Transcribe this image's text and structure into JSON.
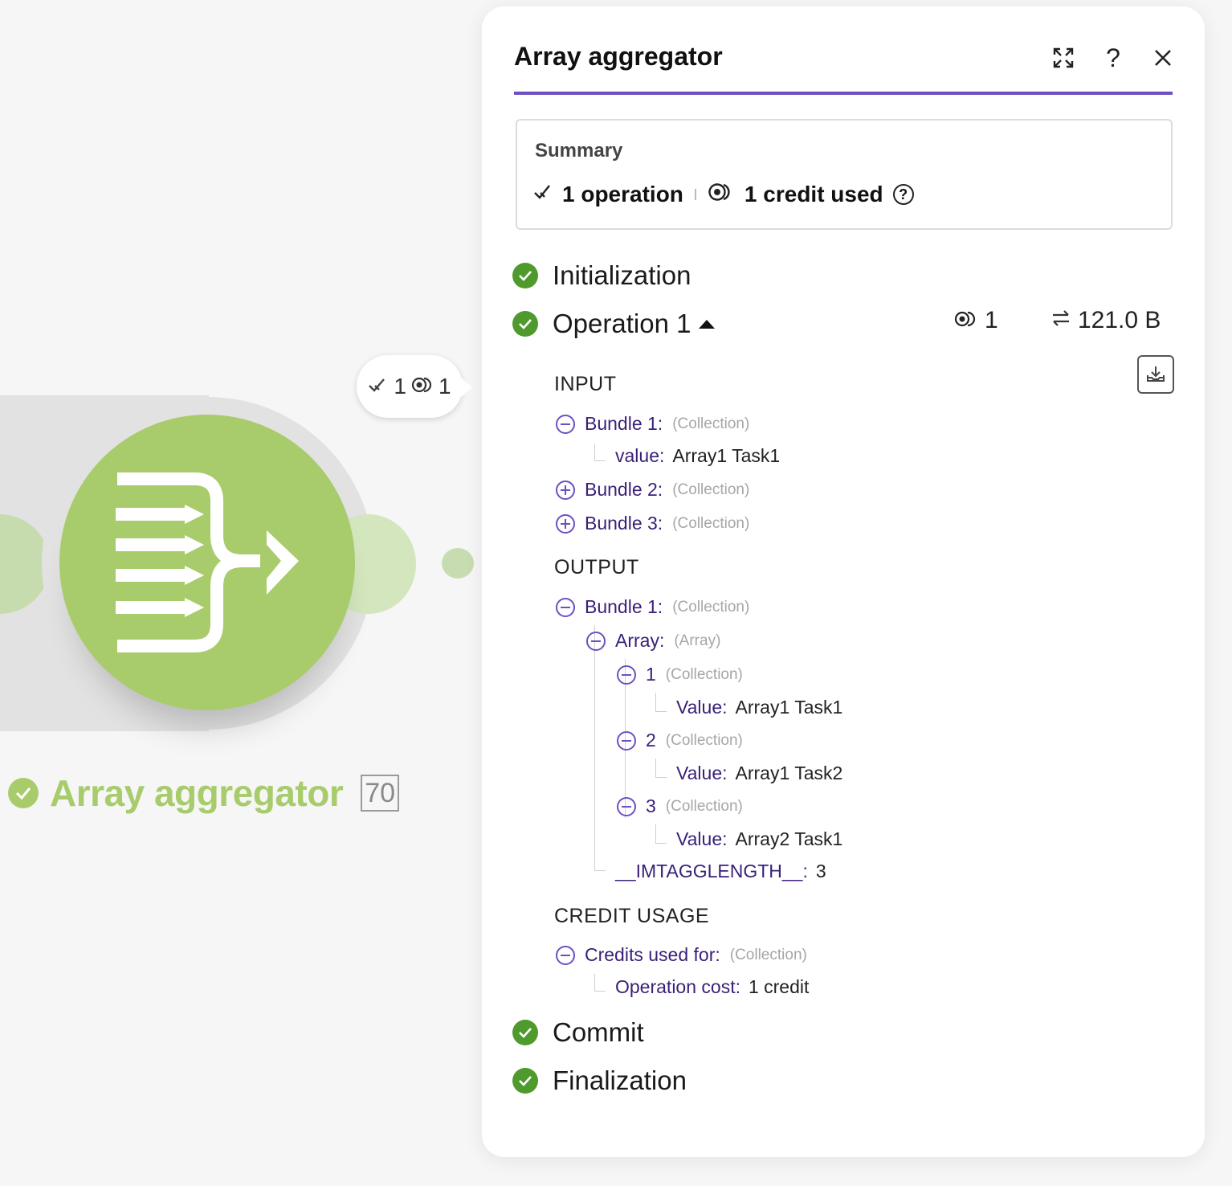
{
  "module": {
    "name": "Array aggregator",
    "id": "70",
    "bubble": {
      "operations": "1",
      "credits": "1"
    }
  },
  "panel": {
    "title": "Array aggregator",
    "summary": {
      "title": "Summary",
      "operations": "1 operation",
      "credits": "1 credit used"
    },
    "phases": {
      "initialization": "Initialization",
      "operation": "Operation 1",
      "commit": "Commit",
      "finalization": "Finalization"
    },
    "operation_stats": {
      "credits": "1",
      "size": "121.0 B"
    },
    "input": {
      "title": "INPUT",
      "bundles": [
        {
          "label": "Bundle 1:",
          "type": "(Collection)",
          "child_key": "value:",
          "child_value": "Array1 Task1"
        },
        {
          "label": "Bundle 2:",
          "type": "(Collection)"
        },
        {
          "label": "Bundle 3:",
          "type": "(Collection)"
        }
      ]
    },
    "output": {
      "title": "OUTPUT",
      "bundle": {
        "label": "Bundle 1:",
        "type": "(Collection)"
      },
      "array": {
        "label": "Array:",
        "type": "(Array)"
      },
      "items": [
        {
          "index": "1",
          "type": "(Collection)",
          "key": "Value:",
          "value": "Array1 Task1"
        },
        {
          "index": "2",
          "type": "(Collection)",
          "key": "Value:",
          "value": "Array1 Task2"
        },
        {
          "index": "3",
          "type": "(Collection)",
          "key": "Value:",
          "value": "Array2 Task1"
        }
      ],
      "length": {
        "key": "__IMTAGGLENGTH__:",
        "value": "3"
      }
    },
    "credit_usage": {
      "title": "CREDIT USAGE",
      "label": "Credits used for:",
      "type": "(Collection)",
      "key": "Operation cost:",
      "value": "1 credit"
    }
  },
  "colors": {
    "accent": "#6d4fc2",
    "module_green": "#a8cc6c",
    "success_green": "#4f9a2c"
  }
}
